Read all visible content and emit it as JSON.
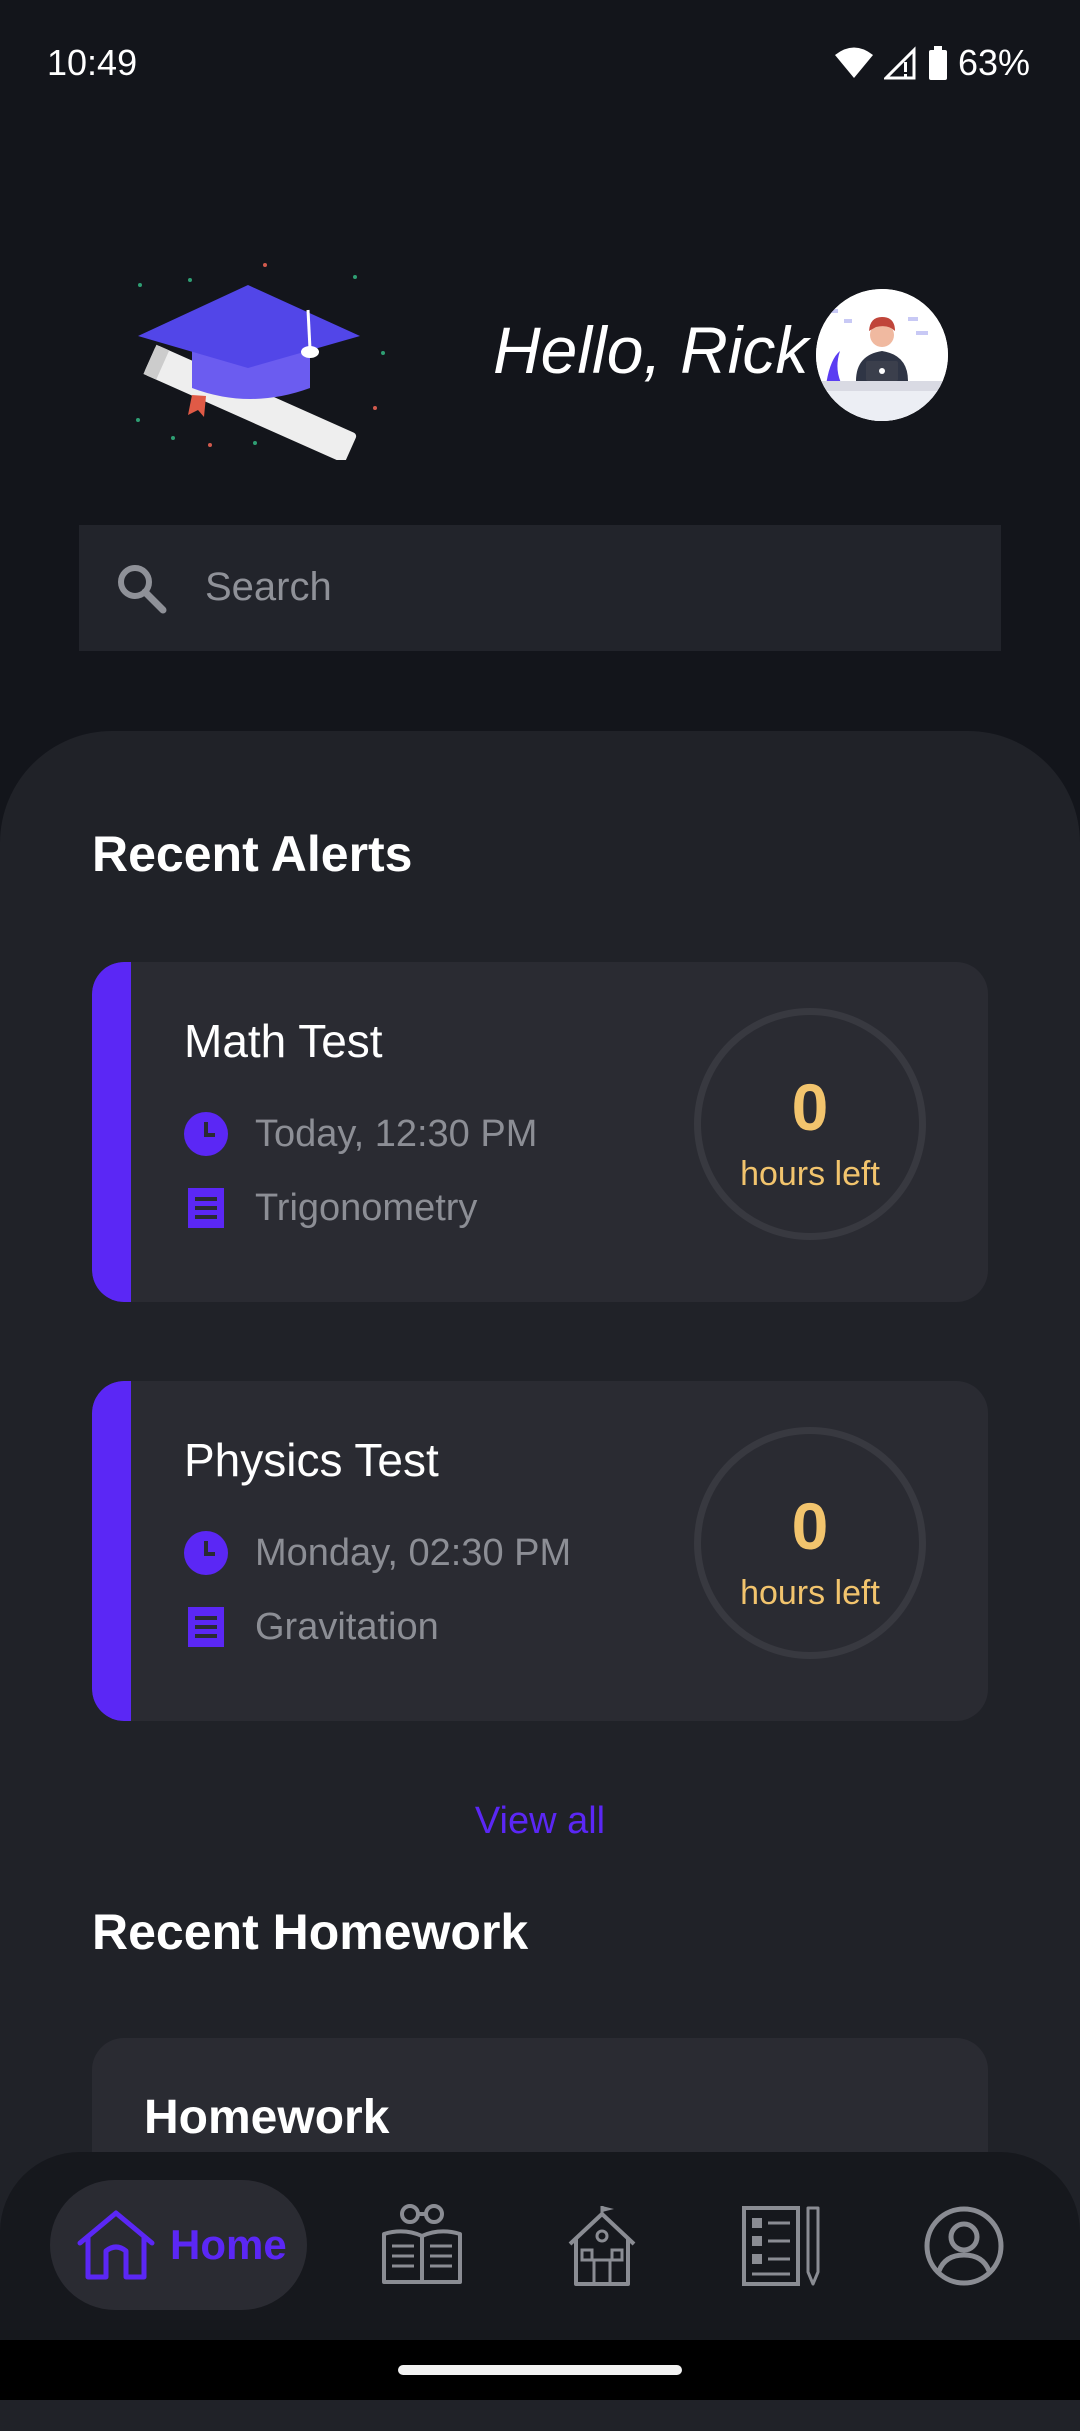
{
  "status_bar": {
    "time": "10:49",
    "battery": "63%"
  },
  "header": {
    "greeting": "Hello, Rick"
  },
  "search": {
    "placeholder": "Search"
  },
  "alerts": {
    "title": "Recent Alerts",
    "items": [
      {
        "title": "Math Test",
        "time": "Today, 12:30 PM",
        "topic": "Trigonometry",
        "hours": "0",
        "hours_label": "hours left"
      },
      {
        "title": "Physics Test",
        "time": "Monday, 02:30 PM",
        "topic": "Gravitation",
        "hours": "0",
        "hours_label": "hours left"
      }
    ],
    "view_all": "View all"
  },
  "homework": {
    "title": "Recent Homework",
    "card_title": "Homework"
  },
  "nav": {
    "home_label": "Home"
  },
  "colors": {
    "accent": "#5b27f5",
    "highlight": "#f2c46d",
    "background": "#13151b",
    "card": "#2a2b32"
  }
}
